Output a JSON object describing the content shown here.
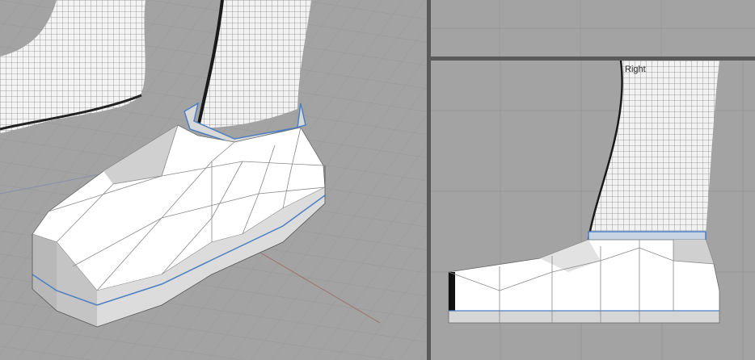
{
  "viewports": {
    "perspective": {
      "name": ""
    },
    "top": {
      "name": ""
    },
    "right": {
      "name": "Right"
    }
  },
  "colors": {
    "viewport_bg": "#a3a3a3",
    "grid": "#979797",
    "border": "#5a5a5a",
    "selection_edge": "#4a7fc4",
    "shoe": "#ffffff",
    "shoe_shade": "#cfcfcf"
  }
}
